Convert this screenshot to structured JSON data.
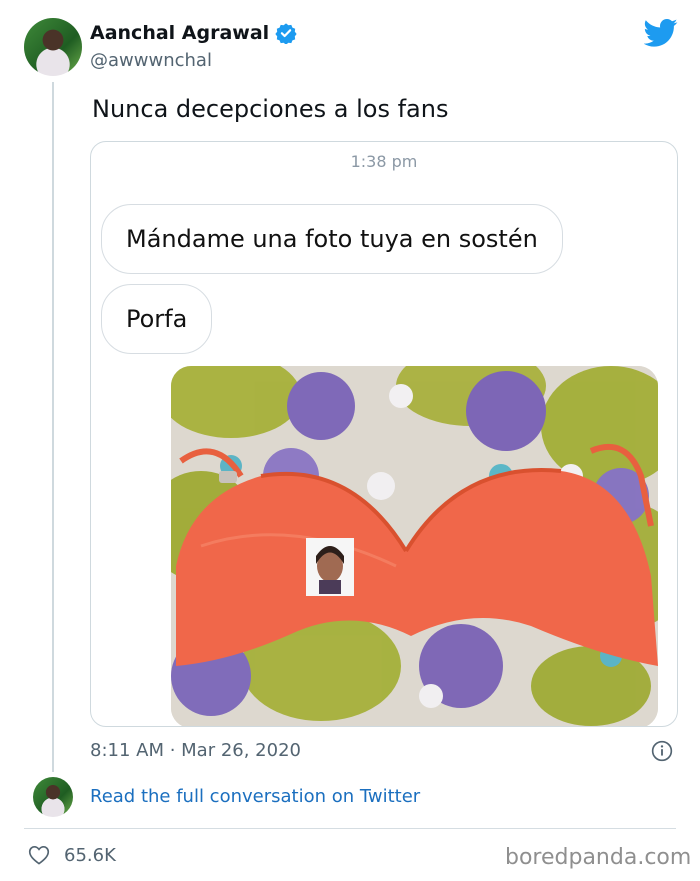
{
  "author": {
    "name": "Aanchal Agrawal",
    "handle": "@awwwnchal"
  },
  "tweet": {
    "text": "Nunca decepciones a los fans",
    "timestamp": "8:11 AM · Mar 26, 2020"
  },
  "chat": {
    "time": "1:38 pm",
    "messages": [
      "Mándame una foto tuya en sostén",
      "Porfa"
    ]
  },
  "footer": {
    "read_link": "Read the full conversation on Twitter",
    "likes": "65.6K",
    "watermark": "boredpanda.com"
  },
  "colors": {
    "twitter_blue": "#1d9bf0",
    "link_blue": "#1b6fbf",
    "bra_orange": "#f0674a"
  },
  "icons": [
    "verified-icon",
    "twitter-bird-icon",
    "info-icon",
    "heart-icon"
  ]
}
